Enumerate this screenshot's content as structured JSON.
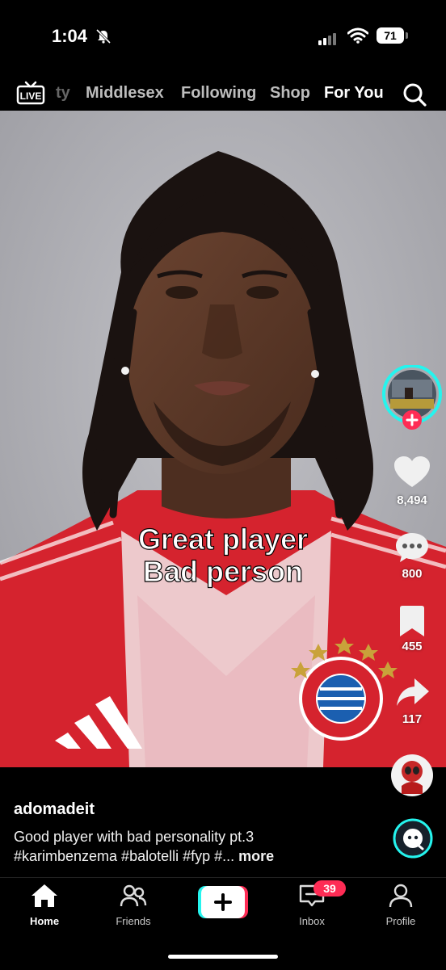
{
  "status_bar": {
    "time": "1:04",
    "battery": "71"
  },
  "top_nav": {
    "live_label": "LIVE",
    "partial_tab": "ty",
    "tabs": [
      "Middlesex",
      "Following",
      "Shop",
      "For You"
    ],
    "active_tab": "For You"
  },
  "video": {
    "overlay_line1": "Great player",
    "overlay_line2": "Bad person",
    "jersey_crest_text": "FC BAYERN MÜNCHEN"
  },
  "actions": {
    "likes": "8,494",
    "comments": "800",
    "saves": "455",
    "shares": "117"
  },
  "post": {
    "username": "adomadeit",
    "caption_line1": "Good player with bad personality pt.3",
    "caption_line2": "#karimbenzema #balotelli #fyp #...",
    "more_label": "more"
  },
  "bottom_nav": {
    "home": "Home",
    "friends": "Friends",
    "inbox": "Inbox",
    "inbox_badge": "39",
    "profile": "Profile"
  },
  "colors": {
    "accent": "#fe2c55",
    "cyan": "#25f4ee",
    "jersey_red": "#d5232e"
  }
}
